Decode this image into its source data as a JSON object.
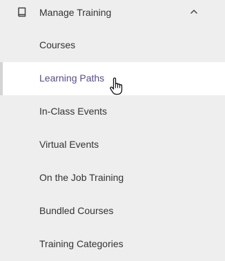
{
  "section": {
    "label": "Manage Training",
    "icon": "book-icon",
    "expanded": true,
    "toggle_icon": "chevron-up-icon"
  },
  "submenu": {
    "items": [
      {
        "label": "Courses",
        "active": false
      },
      {
        "label": "Learning Paths",
        "active": true
      },
      {
        "label": "In-Class Events",
        "active": false
      },
      {
        "label": "Virtual Events",
        "active": false
      },
      {
        "label": "On the Job Training",
        "active": false
      },
      {
        "label": "Bundled Courses",
        "active": false
      },
      {
        "label": "Training Categories",
        "active": false
      }
    ]
  },
  "cursor": {
    "icon": "hand-pointer-icon"
  },
  "colors": {
    "background": "#eeeeee",
    "active_background": "#ffffff",
    "active_text": "#5a4a8a",
    "text": "#333333",
    "active_indicator": "#d4d4d4"
  }
}
